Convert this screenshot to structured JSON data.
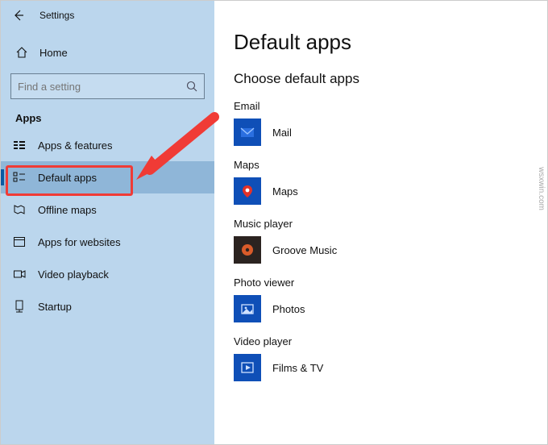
{
  "window": {
    "title": "Settings"
  },
  "sidebar": {
    "home": "Home",
    "search_placeholder": "Find a setting",
    "category": "Apps",
    "items": [
      {
        "label": "Apps & features"
      },
      {
        "label": "Default apps"
      },
      {
        "label": "Offline maps"
      },
      {
        "label": "Apps for websites"
      },
      {
        "label": "Video playback"
      },
      {
        "label": "Startup"
      }
    ]
  },
  "main": {
    "page_title": "Default apps",
    "section_title": "Choose default apps",
    "groups": [
      {
        "label": "Email",
        "app": "Mail"
      },
      {
        "label": "Maps",
        "app": "Maps"
      },
      {
        "label": "Music player",
        "app": "Groove Music"
      },
      {
        "label": "Photo viewer",
        "app": "Photos"
      },
      {
        "label": "Video player",
        "app": "Films & TV"
      }
    ]
  },
  "watermark": "wsxwin.com"
}
